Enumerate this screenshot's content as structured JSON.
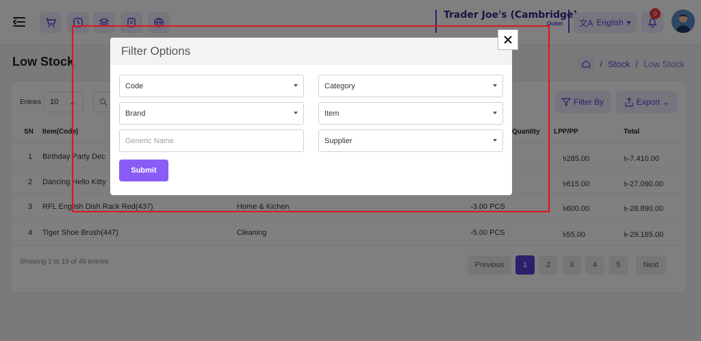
{
  "header": {
    "store_name": "Trader Joe's (Cambridge)",
    "store_sub": "Outlet",
    "language": "English",
    "notification_count": "0",
    "nav_icons": [
      "cart-icon",
      "clock-icon",
      "layers-icon",
      "receipt-icon",
      "globe-icon"
    ]
  },
  "page": {
    "title": "Low Stock",
    "breadcrumb": [
      "Stock",
      "Low Stock"
    ]
  },
  "toolbar": {
    "entries_label": "Entries",
    "entries_value": "10",
    "filter_label": "Filter By",
    "export_label": "Export"
  },
  "table": {
    "headers": [
      "SN",
      "Item(Code)",
      "Quantity",
      "LPP/PP",
      "Total"
    ],
    "rows": [
      {
        "sn": "1",
        "item": "Birthday Party Dec",
        "category": "",
        "quantity": "",
        "lpp": "৳285.00",
        "total": "৳-7.410.00"
      },
      {
        "sn": "2",
        "item": "Dancing Hello Kitty",
        "category": "",
        "quantity": "",
        "lpp": "৳615.00",
        "total": "৳-27.090.00"
      },
      {
        "sn": "3",
        "item": "RFL English Dish Rack Red(437)",
        "category": "Home & Kichen",
        "quantity": "-3.00 PCS",
        "lpp": "৳600.00",
        "total": "৳-28.890.00"
      },
      {
        "sn": "4",
        "item": "Tiger Shoe Brush(447)",
        "category": "Cleaning",
        "quantity": "-5.00 PCS",
        "lpp": "৳55.00",
        "total": "৳-29.165.00"
      }
    ],
    "showing": "Showing 1 to 10 of 49 entries"
  },
  "pagination": {
    "previous": "Previous",
    "pages": [
      "1",
      "2",
      "3",
      "4",
      "5"
    ],
    "next": "Next"
  },
  "modal": {
    "title": "Filter Options",
    "code": "Code",
    "category": "Category",
    "brand": "Brand",
    "item": "Item",
    "generic_placeholder": "Generic Name",
    "supplier": "Supplier",
    "submit": "Submit"
  },
  "colors": {
    "accent": "#5b3fd6",
    "submit": "#8a5cf6",
    "highlight": "#e0141c"
  }
}
